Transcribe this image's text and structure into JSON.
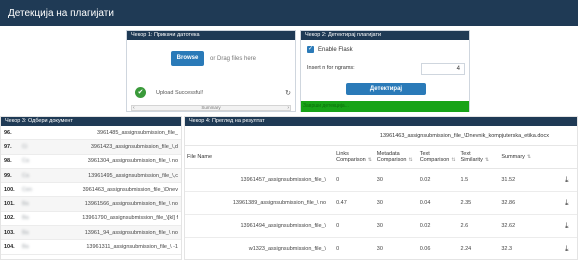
{
  "header": {
    "title": "Детекција на плагијати"
  },
  "step1": {
    "heading": "Чекор 1: Прикачи датотека",
    "browse_label": "Browse",
    "drop_text": "or Drag files here",
    "check_icon": "✔",
    "success_text": "Upload Successful!",
    "refresh_icon": "↻",
    "summary_label": "Summary",
    "arrow_left": "‹",
    "arrow_right": "›"
  },
  "step2": {
    "heading": "Чекор 2: Детектирај плагијати",
    "checkbox_icon": "✓",
    "flask_label": "Enable Flask",
    "ngram_label": "Insert n for ngrams:",
    "ngram_value": "4",
    "detect_label": "Детектирај",
    "status_text": "Заврши детекција..."
  },
  "step3": {
    "heading": "Чекор 3: Одбери документ",
    "documents": [
      {
        "num": "96.",
        "prefix": "",
        "name": "3961485_assignsubmission_file_"
      },
      {
        "num": "97.",
        "prefix": "Ci",
        "name": "3961423_assignsubmission_file_\\,d"
      },
      {
        "num": "98.",
        "prefix": "Ca",
        "name": "3961304_assignsubmission_file_\\ no"
      },
      {
        "num": "99.",
        "prefix": "Ca",
        "name": "13961495_assignsubmission_file_\\,c"
      },
      {
        "num": "100.",
        "prefix": "Cen",
        "name": "3961463_assignsubmission_file_\\Dnev"
      },
      {
        "num": "101.",
        "prefix": "Ba",
        "name": "13961566_assignsubmission_file_\\ no"
      },
      {
        "num": "102.",
        "prefix": "Ba",
        "name": "13961790_assignsubmission_file_\\[kl] f"
      },
      {
        "num": "103.",
        "prefix": "Ba",
        "name": "13961_94_assignsubmission_file_\\ no"
      },
      {
        "num": "104.",
        "prefix": "Ba",
        "name": "13961311_assignsubmission_file_\\ -1"
      }
    ]
  },
  "step4": {
    "heading": "Чекор 4: Преглед на резултат",
    "comparison_file": "13961463_assignsubmission_file_\\Dnevnik_kompjuterska_etika.docx",
    "download_icon": "⤓",
    "sort_icon": "⇅",
    "columns": {
      "file_name": "File Name",
      "links": "Links\nComparison",
      "metadata": "Metadata\nComparison",
      "text_cmp": "Text\nComparison",
      "text_sim": "Text\nSimilarity",
      "summary": "Summary"
    },
    "rows": [
      {
        "file": "13961457_assignsubmission_file_\\",
        "links": "0",
        "metadata": "30",
        "text_cmp": "0.02",
        "text_sim": "1.5",
        "summary": "31.52"
      },
      {
        "file": "13961389_assignsubmission_file_\\ no",
        "links": "0.47",
        "metadata": "30",
        "text_cmp": "0.04",
        "text_sim": "2.35",
        "summary": "32.86"
      },
      {
        "file": "13961494_assignsubmission_file_\\",
        "links": "0",
        "metadata": "30",
        "text_cmp": "0.02",
        "text_sim": "2.6",
        "summary": "32.62"
      },
      {
        "file": "w1323_assignsubmission_file_\\",
        "links": "0",
        "metadata": "30",
        "text_cmp": "0.06",
        "text_sim": "2.24",
        "summary": "32.3"
      }
    ]
  },
  "colors": {
    "header": "#1f3a55",
    "button": "#2a7ab8",
    "success": "#17a317"
  }
}
